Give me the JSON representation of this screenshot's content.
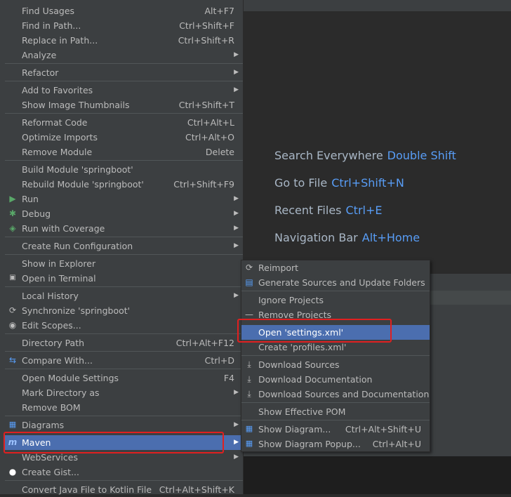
{
  "menu": {
    "items": [
      {
        "label": "Find Usages",
        "shortcut": "Alt+F7"
      },
      {
        "label": "Find in Path...",
        "shortcut": "Ctrl+Shift+F"
      },
      {
        "label": "Replace in Path...",
        "shortcut": "Ctrl+Shift+R"
      },
      {
        "label": "Analyze",
        "shortcut": ""
      },
      {
        "label": "Refactor",
        "shortcut": ""
      },
      {
        "label": "Add to Favorites",
        "shortcut": ""
      },
      {
        "label": "Show Image Thumbnails",
        "shortcut": "Ctrl+Shift+T"
      },
      {
        "label": "Reformat Code",
        "shortcut": "Ctrl+Alt+L"
      },
      {
        "label": "Optimize Imports",
        "shortcut": "Ctrl+Alt+O"
      },
      {
        "label": "Remove Module",
        "shortcut": "Delete"
      },
      {
        "label": "Build Module 'springboot'",
        "shortcut": ""
      },
      {
        "label": "Rebuild Module 'springboot'",
        "shortcut": "Ctrl+Shift+F9"
      },
      {
        "label": "Run",
        "shortcut": ""
      },
      {
        "label": "Debug",
        "shortcut": ""
      },
      {
        "label": "Run with Coverage",
        "shortcut": ""
      },
      {
        "label": "Create Run Configuration",
        "shortcut": ""
      },
      {
        "label": "Show in Explorer",
        "shortcut": ""
      },
      {
        "label": "Open in Terminal",
        "shortcut": ""
      },
      {
        "label": "Local History",
        "shortcut": ""
      },
      {
        "label": "Synchronize 'springboot'",
        "shortcut": ""
      },
      {
        "label": "Edit Scopes...",
        "shortcut": ""
      },
      {
        "label": "Directory Path",
        "shortcut": "Ctrl+Alt+F12"
      },
      {
        "label": "Compare With...",
        "shortcut": "Ctrl+D"
      },
      {
        "label": "Open Module Settings",
        "shortcut": "F4"
      },
      {
        "label": "Mark Directory as",
        "shortcut": ""
      },
      {
        "label": "Remove BOM",
        "shortcut": ""
      },
      {
        "label": "Diagrams",
        "shortcut": ""
      },
      {
        "label": "Maven",
        "shortcut": ""
      },
      {
        "label": "WebServices",
        "shortcut": ""
      },
      {
        "label": "Create Gist...",
        "shortcut": ""
      },
      {
        "label": "Convert Java File to Kotlin File",
        "shortcut": "Ctrl+Alt+Shift+K"
      }
    ]
  },
  "maven_submenu": {
    "items": [
      {
        "label": "Reimport",
        "shortcut": ""
      },
      {
        "label": "Generate Sources and Update Folders",
        "shortcut": ""
      },
      {
        "label": "Ignore Projects",
        "shortcut": ""
      },
      {
        "label": "Remove Projects",
        "shortcut": ""
      },
      {
        "label": "Open 'settings.xml'",
        "shortcut": ""
      },
      {
        "label": "Create 'profiles.xml'",
        "shortcut": ""
      },
      {
        "label": "Download Sources",
        "shortcut": ""
      },
      {
        "label": "Download Documentation",
        "shortcut": ""
      },
      {
        "label": "Download Sources and Documentation",
        "shortcut": ""
      },
      {
        "label": "Show Effective POM",
        "shortcut": ""
      },
      {
        "label": "Show Diagram...",
        "shortcut": "Ctrl+Alt+Shift+U"
      },
      {
        "label": "Show Diagram Popup...",
        "shortcut": "Ctrl+Alt+U"
      }
    ]
  },
  "welcome": {
    "search_everywhere": {
      "label": "Search Everywhere",
      "key": "Double Shift"
    },
    "go_to_file": {
      "label": "Go to File",
      "key": "Ctrl+Shift+N"
    },
    "recent_files": {
      "label": "Recent Files",
      "key": "Ctrl+E"
    },
    "navigation_bar": {
      "label": "Navigation Bar",
      "key": "Alt+Home"
    }
  },
  "colors": {
    "menu_bg": "#3c3f41",
    "selected_bg": "#4b6eaf",
    "shortcut_blue": "#589df6",
    "highlight_red": "#e02020"
  }
}
